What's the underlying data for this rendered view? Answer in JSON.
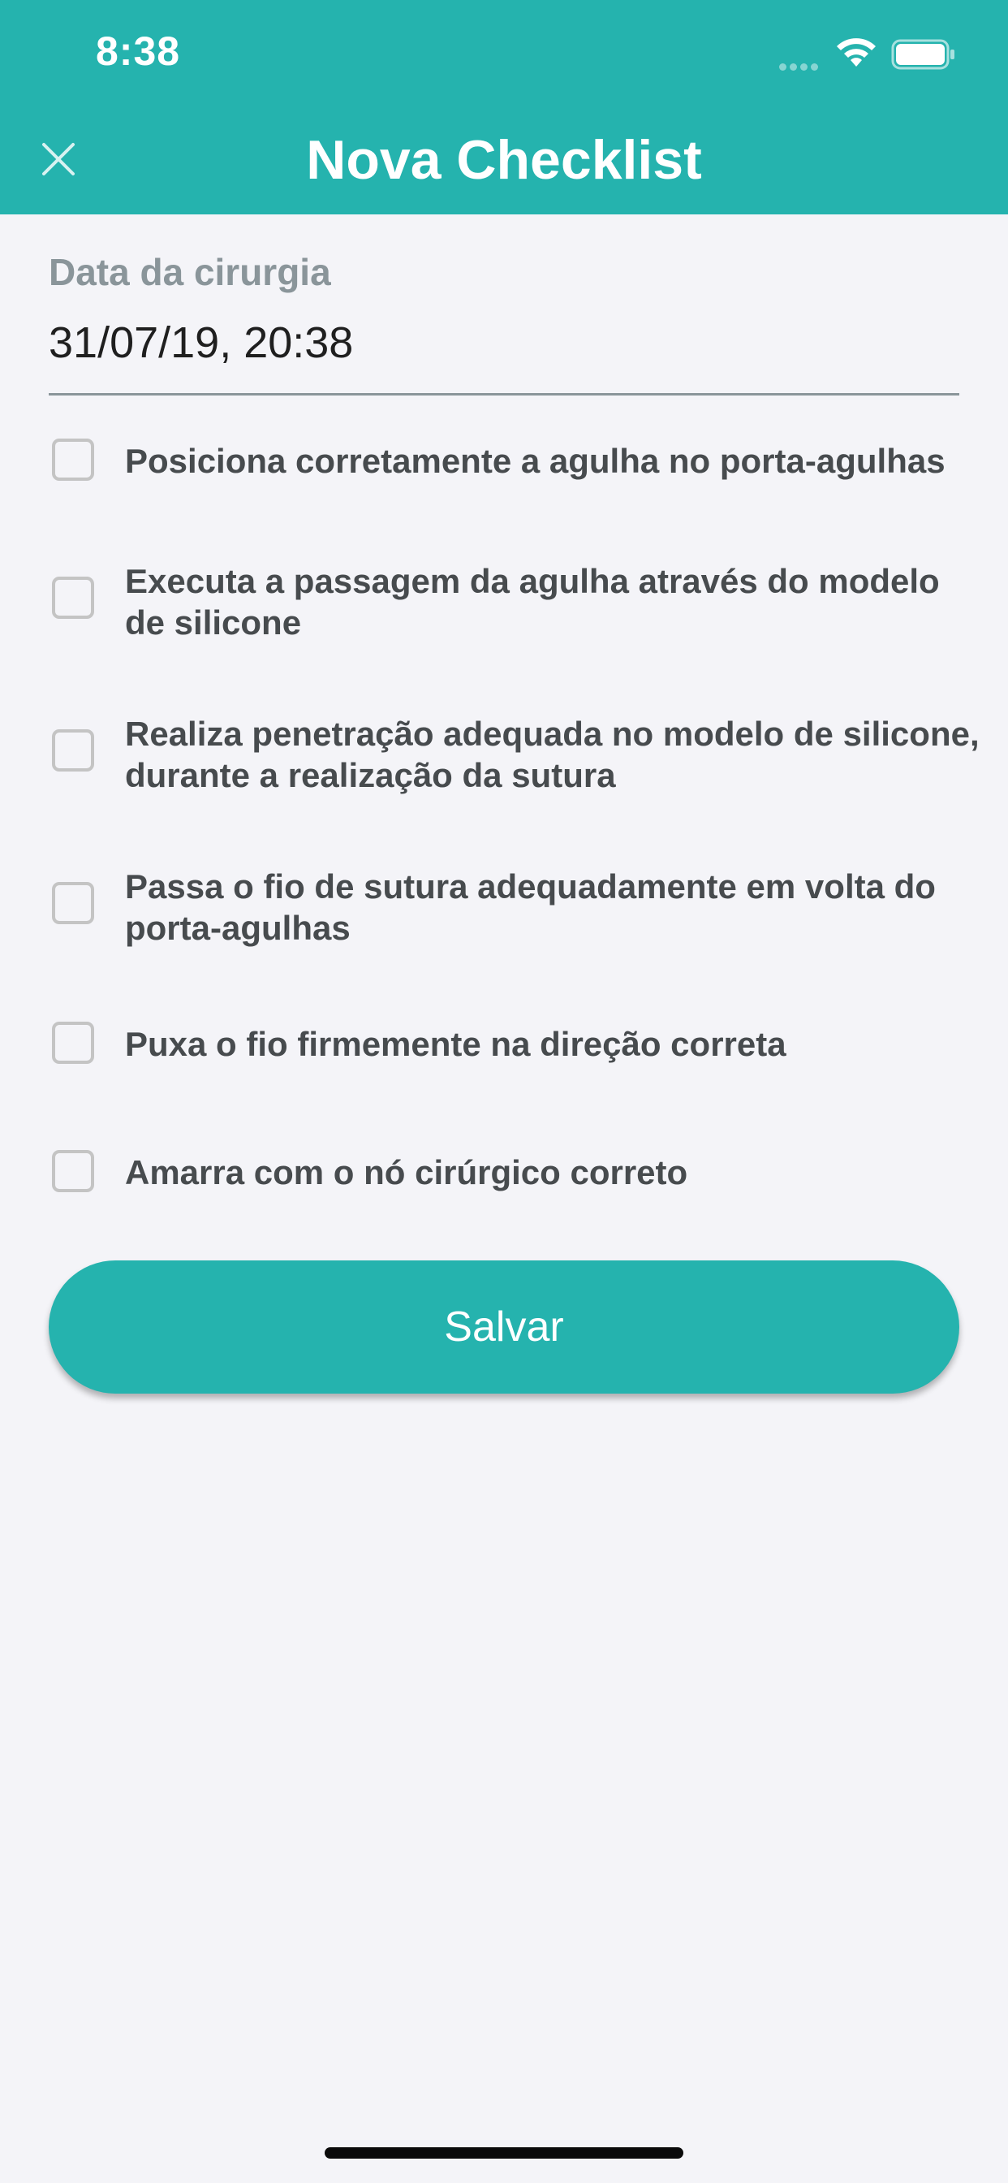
{
  "status_bar": {
    "time": "8:38"
  },
  "header": {
    "title": "Nova Checklist",
    "close_icon": "close-icon"
  },
  "form": {
    "date_label": "Data da cirurgia",
    "date_value": "31/07/19, 20:38"
  },
  "checklist": [
    {
      "label": "Posiciona corretamente a agulha no porta-agulhas",
      "checked": false
    },
    {
      "label": "Executa a passagem da agulha através do modelo de silicone",
      "checked": false
    },
    {
      "label": "Realiza penetração adequada no modelo de silicone, durante a realização da sutura",
      "checked": false
    },
    {
      "label": "Passa o fio de sutura adequadamente em volta do porta-agulhas",
      "checked": false
    },
    {
      "label": "Puxa o fio firmemente na direção correta",
      "checked": false
    },
    {
      "label": "Amarra com o nó cirúrgico correto",
      "checked": false
    }
  ],
  "actions": {
    "save_label": "Salvar"
  },
  "colors": {
    "accent": "#25b3ae",
    "background": "#f4f4f8",
    "text": "#474b4e",
    "label": "#8a959a"
  }
}
